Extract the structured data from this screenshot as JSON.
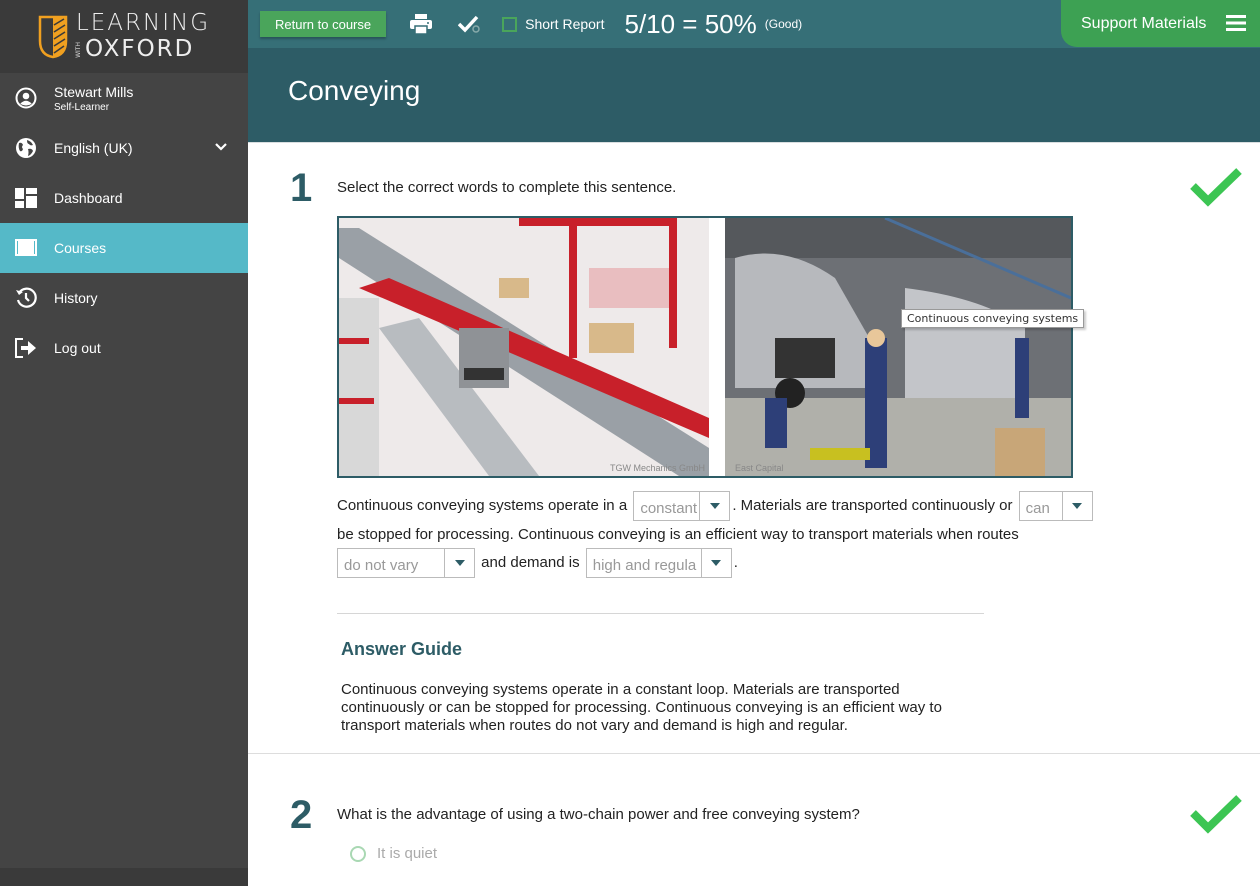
{
  "sidebar": {
    "logo": {
      "line1": "LEARNING",
      "with": "WITH",
      "line2": "OXFORD"
    },
    "user": {
      "name": "Stewart Mills",
      "role": "Self-Learner",
      "icon": "user-circle-icon"
    },
    "language": {
      "label": "English (UK)",
      "icon": "globe-icon"
    },
    "items": [
      {
        "label": "Dashboard",
        "icon": "dashboard-icon",
        "active": false
      },
      {
        "label": "Courses",
        "icon": "book-icon",
        "active": true
      },
      {
        "label": "History",
        "icon": "history-icon",
        "active": false
      },
      {
        "label": "Log out",
        "icon": "logout-icon",
        "active": false
      }
    ]
  },
  "toolbar": {
    "return_label": "Return to course",
    "print_icon": "printer-icon",
    "check_icon": "check-settings-icon",
    "short_report_label": "Short Report",
    "short_report_checked": false,
    "score": "5/10 = 50%",
    "score_label": "(Good)",
    "support_label": "Support Materials",
    "menu_icon": "hamburger-icon"
  },
  "page": {
    "title": "Conveying"
  },
  "questions": [
    {
      "number": "1",
      "prompt": "Select the correct words to complete this sentence.",
      "status": "correct",
      "image_credits": [
        "TGW Mechanics GmbH",
        "East Capital"
      ],
      "tooltip": "Continuous conveying systems",
      "sentence": {
        "p1": "Continuous conveying systems operate in a",
        "d1": "constant",
        "p2": ". Materials are transported continuously or",
        "d2": "can",
        "p3": "be stopped for processing. Continuous conveying is an efficient way to transport materials when routes",
        "d3": "do not vary",
        "p4": "and demand is",
        "d4": "high and regula",
        "p5": "."
      },
      "answer_guide": {
        "title": "Answer Guide",
        "text": "Continuous conveying systems operate in a constant loop. Materials are transported continuously or can be stopped for processing. Continuous conveying is an efficient way to transport materials when routes do not vary and demand is high and regular."
      }
    },
    {
      "number": "2",
      "prompt": "What is the advantage of using a two-chain power and free conveying system?",
      "status": "correct",
      "options": [
        "It is quiet"
      ]
    }
  ],
  "colors": {
    "sidebar_bg": "#444444",
    "active_nav": "#55b9c8",
    "topbar": "#366f77",
    "header": "#2d5c66",
    "green_button": "#4aa55b",
    "support_bg": "#3da153",
    "check_green": "#3cc553"
  }
}
